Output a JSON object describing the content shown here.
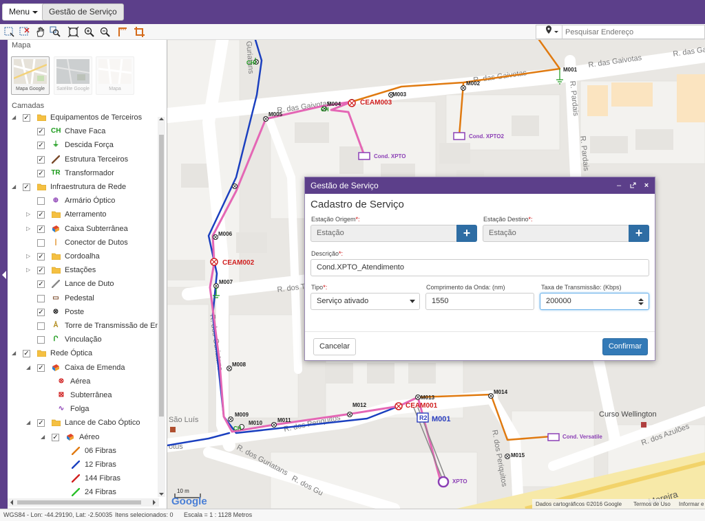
{
  "topbar": {
    "menu_label": "Menu",
    "gestao_label": "Gestão de Serviço"
  },
  "search": {
    "placeholder": "Pesquisar Endereço"
  },
  "panel": {
    "mapa_title": "Mapa",
    "camadas_title": "Camadas",
    "basemaps": [
      {
        "label": "Mapa Google",
        "selected": true
      },
      {
        "label": "Satélite Google",
        "selected": false
      },
      {
        "label": "Mapa",
        "selected": false
      }
    ],
    "layers": [
      {
        "label": "Equipamentos de Terceiros",
        "checked": true,
        "expander": "◢",
        "icon": "folder-icon"
      },
      {
        "label": "Chave Faca",
        "checked": true,
        "icon": "chave-faca-icon",
        "glyph": "CH",
        "color": "#1a9a1a"
      },
      {
        "label": "Descida Força",
        "checked": true,
        "icon": "descida-forca-icon",
        "glyph": "⏚",
        "color": "#1a9a1a"
      },
      {
        "label": "Estrutura Terceiros",
        "checked": true,
        "icon": "estrutura-terceiros-icon",
        "glyph": "/",
        "color": "#7a4a2a"
      },
      {
        "label": "Transformador",
        "checked": true,
        "icon": "transformador-icon",
        "glyph": "TR",
        "color": "#1a9a1a"
      },
      {
        "label": "Infraestrutura de Rede",
        "checked": true,
        "expander": "◢",
        "icon": "folder-icon"
      },
      {
        "label": "Armário Óptico",
        "checked": false,
        "icon": "armario-optico-icon",
        "glyph": "⊕",
        "color": "#8b3fb5"
      },
      {
        "label": "Aterramento",
        "checked": true,
        "expander": "▷",
        "icon": "folder-icon"
      },
      {
        "label": "Caixa Subterrânea",
        "checked": true,
        "expander": "▷",
        "icon": "caixa-subterranea-icon",
        "glyph": "▦",
        "color": "#d46a1a"
      },
      {
        "label": "Conector de Dutos",
        "checked": false,
        "icon": "conector-dutos-icon",
        "glyph": "|",
        "color": "#e08a1a"
      },
      {
        "label": "Cordoalha",
        "checked": true,
        "expander": "▷",
        "icon": "folder-icon"
      },
      {
        "label": "Estações",
        "checked": true,
        "expander": "▷",
        "icon": "folder-icon"
      },
      {
        "label": "Lance de Duto",
        "checked": true,
        "icon": "lance-duto-icon",
        "glyph": "/",
        "color": "#888"
      },
      {
        "label": "Pedestal",
        "checked": false,
        "icon": "pedestal-icon",
        "glyph": "▭",
        "color": "#7a4a2a"
      },
      {
        "label": "Poste",
        "checked": true,
        "icon": "poste-icon",
        "glyph": "⊗",
        "color": "#222"
      },
      {
        "label": "Torre de Transmissão de Ene",
        "checked": false,
        "icon": "torre-icon",
        "glyph": "Å",
        "color": "#b08a1a"
      },
      {
        "label": "Vinculação",
        "checked": false,
        "icon": "vinculacao-icon",
        "glyph": "Ր",
        "color": "#1a9a1a"
      },
      {
        "label": "Rede Óptica",
        "checked": true,
        "expander": "◢",
        "icon": "folder-icon"
      },
      {
        "label": "Caixa de Emenda",
        "checked": true,
        "expander": "◢",
        "icon": "caixa-emenda-icon",
        "glyph": "▦",
        "color": "#d46a1a"
      },
      {
        "label": "Aérea",
        "checked": null,
        "icon": "aerea-icon",
        "glyph": "⊗",
        "color": "#d02020"
      },
      {
        "label": "Subterrânea",
        "checked": null,
        "icon": "subterranea-icon",
        "glyph": "⊠",
        "color": "#d02020"
      },
      {
        "label": "Folga",
        "checked": null,
        "icon": "folga-icon",
        "glyph": "∿",
        "color": "#8b3fb5"
      },
      {
        "label": "Lance de Cabo Óptico",
        "checked": true,
        "expander": "◢",
        "icon": "folder-icon"
      },
      {
        "label": "Aéreo",
        "checked": true,
        "expander": "◢",
        "icon": "aereo-icon",
        "glyph": "▦",
        "color": "#d46a1a"
      },
      {
        "label": "06 Fibras",
        "checked": null,
        "icon": "line-06-icon",
        "glyph": "/",
        "color": "#e07a10"
      },
      {
        "label": "12 Fibras",
        "checked": null,
        "icon": "line-12-icon",
        "glyph": "/",
        "color": "#1a3fbf"
      },
      {
        "label": "144 Fibras",
        "checked": null,
        "icon": "line-144-icon",
        "glyph": "/",
        "color": "#d02020"
      },
      {
        "label": "24 Fibras",
        "checked": null,
        "icon": "line-24-icon",
        "glyph": "/",
        "color": "#2ac02a"
      }
    ]
  },
  "map": {
    "streets": {
      "gaivotas_1": "R. das Gaivotas",
      "gaivotas_2": "R. das Gaivotas",
      "gaivotas_3": "R. das Gaivotas",
      "gaivotas_4": "R. das Gaivotas",
      "pardais_1": "R. Pardais",
      "pardais_2": "R. Pardais",
      "guriatans_top": "Guriatans",
      "guriatans_mid": "R. dos Guriatans",
      "guriatans_bot": "R. dos Guriatans",
      "guriatans_bot2": "R. dos Gu",
      "dos_t": "R. dos T",
      "perequitos_1": "R. dos Periquitos",
      "perequitos_2": "R. dos Periquitos",
      "azuloes": "R. dos Azulões",
      "moreira": "Moreira",
      "sao_luis": "São Luís",
      "otus": "otus",
      "curso": "Curso Wellington"
    },
    "nodes": {
      "M001_top": "M001",
      "M002": "M002",
      "M003": "M003",
      "M004": "M004",
      "M005": "M005",
      "M006": "M006",
      "M007": "M007",
      "M008": "M008",
      "M009": "M009",
      "M010": "M010",
      "M011": "M011",
      "M012": "M012",
      "M013": "M013",
      "M014": "M014",
      "M015": "M015",
      "CEAM001": "CEAM001",
      "CEAM002": "CEAM002",
      "CEAM003": "CEAM003",
      "M001_box": "M001",
      "box_num": "R2",
      "XPTO": "XPTO",
      "CH_1": "CH",
      "CH_2": "CH",
      "CH_3": "CH",
      "CH_4": "CH",
      "cond_xpto": "Cond. XPTO",
      "cond_xpto2": "Cond. XPTO2",
      "cond_versatile": "Cond. Versatile"
    },
    "scale_label": "10 m",
    "google_logo": "Google",
    "attribution": "Dados cartográficos ©2016 Google",
    "terms": "Termos de Uso",
    "report": "Informar e"
  },
  "status": {
    "coords": "WGS84 - Lon: -44.29190, Lat: -2.50035",
    "selected": "Itens selecionados: 0",
    "scale": "Escala = 1 : 1128 Metros"
  },
  "dialog": {
    "header": "Gestão de Serviço",
    "title": "Cadastro de Serviço",
    "origem_label": "Estação Origem",
    "origem_value": "Estação",
    "destino_label": "Estação Destino",
    "destino_value": "Estação",
    "descricao_label": "Descrição",
    "descricao_value": "Cond.XPTO_Atendimento",
    "tipo_label": "Tipo",
    "tipo_value": "Serviço ativado",
    "comprimento_label": "Comprimento da Onda: (nm)",
    "comprimento_value": "1550",
    "taxa_label": "Taxa de Transmissão: (Kbps)",
    "taxa_value": "200000",
    "required_mark": "*:",
    "cancel_label": "Cancelar",
    "confirm_label": "Confirmar",
    "plus": "+"
  },
  "colors": {
    "purple_brand": "#5c3f8a",
    "pink_cable": "#e467b5",
    "orange_cable": "#e07a10",
    "blue_cable": "#1a3fbf",
    "primary_button": "#337ab7"
  }
}
